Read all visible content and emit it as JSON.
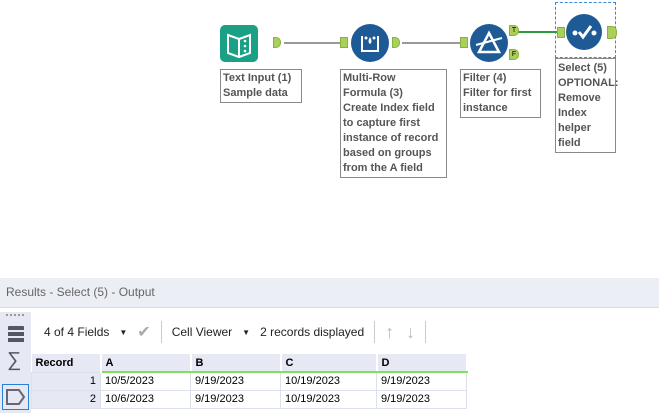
{
  "workflow": {
    "tools": [
      {
        "name": "Text Input (1)",
        "annotation": [
          "Sample data"
        ],
        "icon": "text-input-icon",
        "color": "#1aa085"
      },
      {
        "name": "Multi-Row Formula (3)",
        "annotation": [
          "Create Index field",
          "to capture first",
          "instance of record",
          "based on groups",
          "from the A field"
        ],
        "icon": "multi-row-formula-icon",
        "color": "#1e5b96"
      },
      {
        "name": "Filter (4)",
        "annotation": [
          "Filter for first",
          "instance"
        ],
        "icon": "filter-icon",
        "color": "#1e5b96"
      },
      {
        "name": "Select (5)",
        "annotation": [
          "OPTIONAL:",
          "Remove Index",
          "helper field"
        ],
        "icon": "select-icon",
        "color": "#1e5b96"
      }
    ],
    "filter_true": "T",
    "filter_false": "F",
    "multirow_line1": "Multi-Row",
    "multirow_line2": "Formula (3)"
  },
  "results": {
    "title": "Results - Select (5) - Output",
    "fields_label": "4 of 4 Fields",
    "viewer_label": "Cell Viewer",
    "records_label": "2 records displayed",
    "columns": [
      "Record",
      "A",
      "B",
      "C",
      "D"
    ],
    "rows": [
      [
        "1",
        "10/5/2023",
        "9/19/2023",
        "10/19/2023",
        "9/19/2023"
      ],
      [
        "2",
        "10/6/2023",
        "9/19/2023",
        "10/19/2023",
        "9/19/2023"
      ]
    ]
  }
}
